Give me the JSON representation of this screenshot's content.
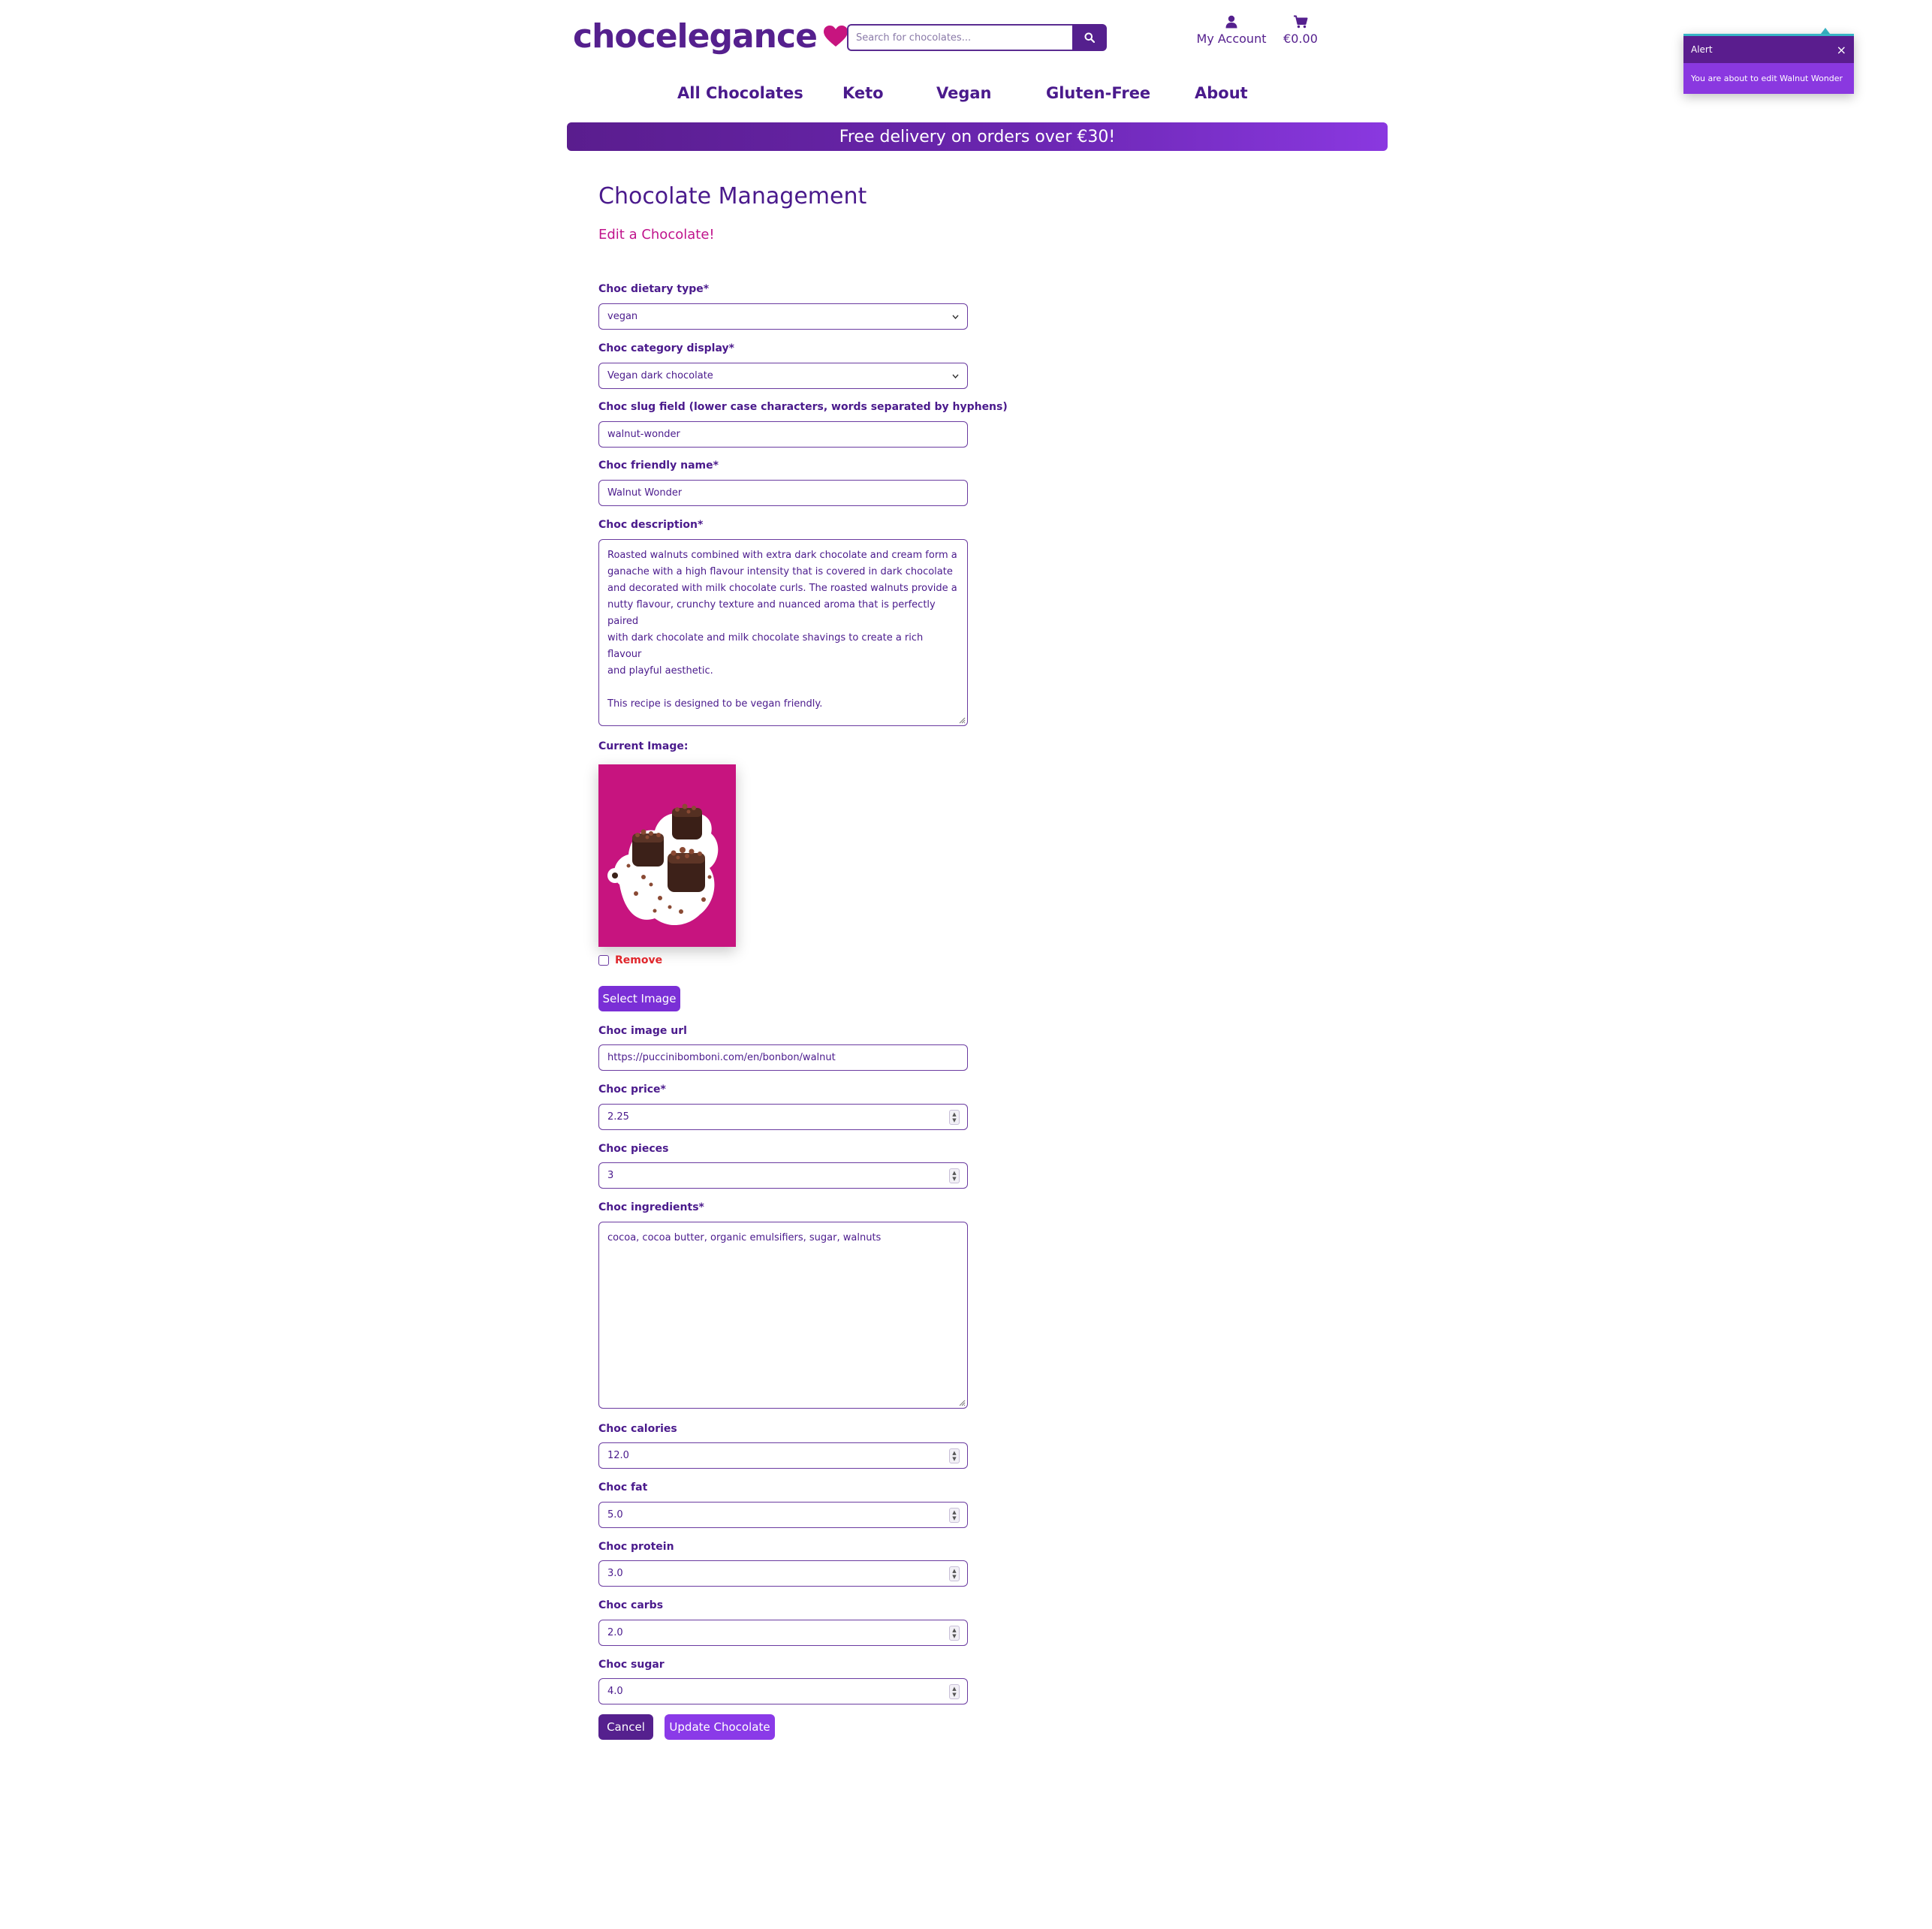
{
  "brand": {
    "name": "chocelegance",
    "heart_color": "#c7147f",
    "primary_color": "#55208e"
  },
  "search": {
    "placeholder": "Search for chocolates..."
  },
  "header": {
    "account_label": "My Account",
    "cart_total": "€0.00"
  },
  "nav": {
    "items": [
      "All Chocolates",
      "Keto",
      "Vegan",
      "Gluten-Free",
      "About"
    ]
  },
  "banner": {
    "text": "Free delivery on orders over €30!"
  },
  "page": {
    "title": "Chocolate Management",
    "subtitle": "Edit a Chocolate!"
  },
  "form": {
    "dietary_type": {
      "label": "Choc dietary type*",
      "value": "vegan"
    },
    "category": {
      "label": "Choc category display*",
      "value": "Vegan dark chocolate"
    },
    "slug": {
      "label": "Choc slug field (lower case characters, words separated by hyphens)",
      "value": "walnut-wonder"
    },
    "friendly_name": {
      "label": "Choc friendly name*",
      "value": "Walnut Wonder"
    },
    "description": {
      "label": "Choc description*",
      "lines": [
        "Roasted walnuts combined with extra dark chocolate and cream form a",
        "ganache with a high flavour intensity that is covered in dark chocolate",
        "and decorated with milk chocolate curls. The roasted walnuts provide a",
        "nutty flavour, crunchy texture and nuanced aroma that is perfectly paired",
        "with dark chocolate and milk chocolate shavings to create a rich flavour",
        "and playful aesthetic."
      ],
      "line2": "This recipe is designed to be vegan friendly."
    },
    "current_image": {
      "label": "Current Image:",
      "remove_label": "Remove"
    },
    "select_image_button": "Select Image",
    "image_url": {
      "label": "Choc image url",
      "value": "https://puccinibomboni.com/en/bonbon/walnut"
    },
    "price": {
      "label": "Choc price*",
      "value": "2.25"
    },
    "pieces": {
      "label": "Choc pieces",
      "value": "3"
    },
    "ingredients": {
      "label": "Choc ingredients*",
      "value": "cocoa, cocoa butter, organic emulsifiers, sugar, walnuts"
    },
    "calories": {
      "label": "Choc calories",
      "value": "12.0"
    },
    "fat": {
      "label": "Choc fat",
      "value": "5.0"
    },
    "protein": {
      "label": "Choc protein",
      "value": "3.0"
    },
    "carbs": {
      "label": "Choc carbs",
      "value": "2.0"
    },
    "sugar": {
      "label": "Choc sugar",
      "value": "4.0"
    },
    "cancel_button": "Cancel",
    "update_button": "Update Chocolate"
  },
  "alert": {
    "title": "Alert",
    "message": "You are about to edit Walnut Wonder",
    "close_glyph": "×"
  },
  "icons": {
    "search": "search-icon",
    "account": "user-icon",
    "cart": "cart-icon",
    "close": "close-icon",
    "caret": "chevron-down-icon"
  }
}
